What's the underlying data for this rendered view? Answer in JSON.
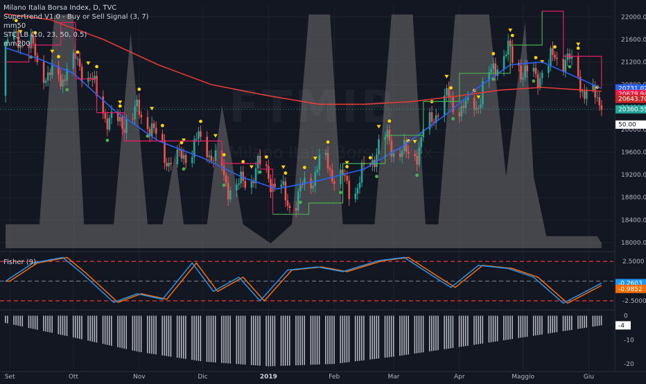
{
  "header": {
    "title": "Milano Italia Borsa Index, D, TVC",
    "indicators": [
      "Supertrend V1.0 - Buy or Sell Signal (3, 7)",
      "mm50",
      "STC_LB (10, 23, 50, 0.5)",
      "mm200"
    ]
  },
  "watermark": {
    "symbol": "FTMIB",
    "name": "Milano Italia Borsa Index"
  },
  "fisher_panel": {
    "title": "Fisher (9)"
  },
  "x_axis": {
    "labels": [
      "Set",
      "Ott",
      "Nov",
      "Dic",
      "2019",
      "Feb",
      "Mar",
      "Apr",
      "Maggio",
      "Giu"
    ]
  },
  "colors": {
    "background": "#131722",
    "candle_up": "#26a69a",
    "candle_down": "#ef5350",
    "mm50": "#2962ff",
    "mm200": "#e53935",
    "supertrend_down": "#e91e63",
    "supertrend_up": "#4caf50",
    "stc_fill": "#6e6e6e",
    "fisher": "#2196f3",
    "fisher_trigger": "#ff6d00",
    "signal_dots": "#ffd600"
  },
  "chart_data": [
    {
      "type": "line",
      "title": "Milano Italia Borsa Index, D, TVC",
      "ylim": [
        17900,
        22200
      ],
      "y_ticks": [
        18000,
        18400,
        18800,
        19200,
        19600,
        20000,
        20400,
        20800,
        21200,
        21600,
        22000
      ],
      "price_labels": [
        {
          "label": "20731.02",
          "color": "#2962ff"
        },
        {
          "label": "20679.94",
          "color": "#ff1744"
        },
        {
          "label": "20643.70",
          "color": "#c62828"
        },
        {
          "label": "20360.59",
          "color": "#26a69a"
        },
        {
          "label": "50.00",
          "color": "#ffffff"
        }
      ],
      "series": [
        {
          "name": "mm50",
          "x": [
            "2018-08-30",
            "2018-09-15",
            "2018-10-01",
            "2018-10-20",
            "2018-11-10",
            "2018-12-01",
            "2018-12-20",
            "2019-01-05",
            "2019-01-25",
            "2019-02-15",
            "2019-03-05",
            "2019-03-25",
            "2019-04-10",
            "2019-04-25",
            "2019-05-10",
            "2019-05-25",
            "2019-06-07"
          ],
          "values": [
            21450,
            21250,
            21000,
            20350,
            19800,
            19500,
            19150,
            18950,
            19100,
            19300,
            19700,
            20250,
            20750,
            21150,
            21200,
            20950,
            20731
          ]
        },
        {
          "name": "mm200",
          "x": [
            "2018-08-30",
            "2018-09-20",
            "2018-10-15",
            "2018-11-10",
            "2018-12-05",
            "2019-01-01",
            "2019-01-25",
            "2019-02-15",
            "2019-03-10",
            "2019-04-01",
            "2019-04-20",
            "2019-05-10",
            "2019-06-07"
          ],
          "values": [
            22050,
            21950,
            21600,
            21150,
            20800,
            20600,
            20450,
            20450,
            20500,
            20600,
            20700,
            20750,
            20680
          ]
        },
        {
          "name": "supertrend",
          "x": [
            "2018-08-30",
            "2018-09-10",
            "2018-09-25",
            "2018-10-02",
            "2018-10-12",
            "2018-10-25",
            "2018-11-20",
            "2018-12-03",
            "2018-12-10",
            "2018-12-28",
            "2019-01-03",
            "2019-01-20",
            "2019-02-05",
            "2019-02-25",
            "2019-03-15",
            "2019-04-01",
            "2019-04-25",
            "2019-05-10",
            "2019-05-20",
            "2019-06-07"
          ],
          "values": [
            21200,
            21500,
            21900,
            20900,
            20300,
            19800,
            19800,
            19800,
            19400,
            19300,
            18500,
            18700,
            19400,
            19900,
            20500,
            21000,
            21500,
            22100,
            21300,
            20750
          ]
        }
      ]
    },
    {
      "type": "line",
      "title": "Fisher (9)",
      "ylim": [
        -3.2,
        3.3
      ],
      "y_ticks": [
        2.5,
        0,
        -2.5
      ],
      "levels": [
        2.5,
        0,
        -2.5
      ],
      "price_labels": [
        {
          "label": "-0.2603",
          "color": "#2196f3"
        },
        {
          "label": "-0.9852",
          "color": "#ff6d00"
        }
      ],
      "series": [
        {
          "name": "Fisher",
          "x": [
            "2018-08-30",
            "2018-09-12",
            "2018-09-26",
            "2018-10-05",
            "2018-10-20",
            "2018-10-31",
            "2018-11-12",
            "2018-11-26",
            "2018-12-06",
            "2018-12-18",
            "2018-12-28",
            "2019-01-10",
            "2019-01-24",
            "2019-02-05",
            "2019-02-22",
            "2019-03-06",
            "2019-03-18",
            "2019-03-28",
            "2019-04-10",
            "2019-04-24",
            "2019-05-06",
            "2019-05-20",
            "2019-06-07"
          ],
          "values": [
            0.0,
            2.3,
            3.0,
            1.0,
            -2.7,
            -1.6,
            -2.3,
            2.3,
            -1.3,
            0.5,
            -2.5,
            1.4,
            1.8,
            1.2,
            2.6,
            3.0,
            0.9,
            -0.8,
            2.0,
            1.6,
            0.5,
            -2.8,
            -0.26
          ]
        }
      ]
    },
    {
      "type": "bar",
      "title": "",
      "ylim": [
        -22,
        1
      ],
      "y_ticks": [
        0,
        -10,
        -20
      ],
      "price_labels": [
        {
          "label": "-4",
          "color": "#ffffff"
        }
      ],
      "x": [
        "2018-08-30",
        "2018-10-01",
        "2018-11-01",
        "2018-12-01",
        "2019-01-01",
        "2019-02-01",
        "2019-03-01",
        "2019-04-01",
        "2019-05-01",
        "2019-06-07"
      ],
      "values": [
        -3,
        -9,
        -15,
        -19,
        -21,
        -20,
        -17,
        -13,
        -9,
        -4
      ]
    }
  ]
}
